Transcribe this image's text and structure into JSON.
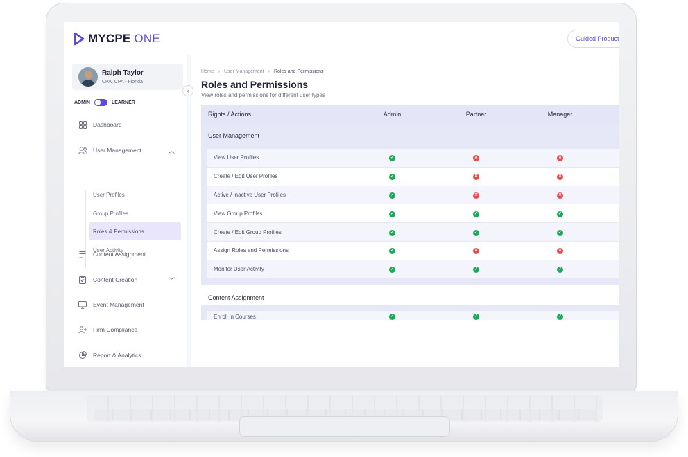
{
  "brand": {
    "name_main": "MYCPE",
    "name_accent": "ONE",
    "accent_color": "#5b4bd6"
  },
  "header": {
    "guided_button": "Guided Product"
  },
  "user": {
    "name": "Ralph Taylor",
    "subtitle": "CPA, CPA - Florida"
  },
  "role_toggle": {
    "left": "ADMIN",
    "right": "LEARNER"
  },
  "sidebar": {
    "items": [
      {
        "label": "Dashboard",
        "icon": "grid-icon"
      },
      {
        "label": "User Management",
        "icon": "users-icon"
      },
      {
        "label": "Content Assignment",
        "icon": "list-icon"
      },
      {
        "label": "Content Creation",
        "icon": "clipboard-icon"
      },
      {
        "label": "Event Management",
        "icon": "monitor-icon"
      },
      {
        "label": "Firm Compliance",
        "icon": "user-plus-icon"
      },
      {
        "label": "Report & Analytics",
        "icon": "chart-pie-icon"
      }
    ],
    "user_management_sub": [
      {
        "label": "User Profiles"
      },
      {
        "label": "Group Profiles"
      },
      {
        "label": "Roles & Permissions"
      },
      {
        "label": "User Activity"
      }
    ]
  },
  "breadcrumb": {
    "home": "Home",
    "level1": "User Management",
    "current": "Roles and Permissions"
  },
  "page": {
    "title": "Roles and Permissions",
    "subtitle": "View roles and permissions for different user types"
  },
  "table": {
    "headers": [
      "Rights / Actions",
      "Admin",
      "Partner",
      "Manager"
    ],
    "sections": [
      {
        "title": "User Management",
        "rows": [
          {
            "action": "View User Profiles",
            "admin": true,
            "partner": false,
            "manager": false
          },
          {
            "action": "Create / Edit User Profiles",
            "admin": true,
            "partner": false,
            "manager": false
          },
          {
            "action": "Active / Inactive User Profiles",
            "admin": true,
            "partner": false,
            "manager": false
          },
          {
            "action": "View Group Profiles",
            "admin": true,
            "partner": true,
            "manager": true
          },
          {
            "action": "Create / Edit Group Profiles",
            "admin": true,
            "partner": true,
            "manager": true
          },
          {
            "action": "Assign Roles and Permissions",
            "admin": true,
            "partner": false,
            "manager": false
          },
          {
            "action": "Monitor User Activity",
            "admin": true,
            "partner": true,
            "manager": true
          }
        ]
      },
      {
        "title": "Content Assignment",
        "rows": [
          {
            "action": "Enroll in Courses",
            "admin": true,
            "partner": true,
            "manager": true
          }
        ]
      }
    ]
  },
  "status_colors": {
    "allowed": "#22a55a",
    "denied": "#e04b4b"
  }
}
